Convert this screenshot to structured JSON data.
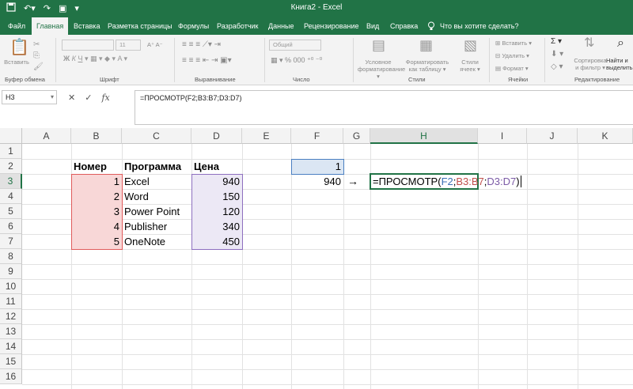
{
  "app": {
    "title": "Книга2 - Excel",
    "qat": {
      "save_icon": "save-icon",
      "undo_icon": "undo-icon",
      "redo_icon": "redo-icon"
    },
    "tell_me": "Что вы хотите сделать?"
  },
  "tabs": [
    "Файл",
    "Главная",
    "Вставка",
    "Разметка страницы",
    "Формулы",
    "Разработчик",
    "Данные",
    "Рецензирование",
    "Вид",
    "Справка"
  ],
  "active_tab": "Главная",
  "ribbon": {
    "groups": [
      "Буфер обмена",
      "Шрифт",
      "Выравнивание",
      "Число",
      "Стили",
      "Ячейки",
      "Редактирование"
    ],
    "paste": "Вставить",
    "font_size": "11",
    "number_format": "Общий",
    "conditional": [
      "Условное",
      "форматирование"
    ],
    "format_table": [
      "Форматировать",
      "как таблицу"
    ],
    "cell_styles": [
      "Стили",
      "ячеек"
    ],
    "cells": [
      "Вставить",
      "Удалить",
      "Формат"
    ],
    "sort": [
      "Сортировка",
      "и фильтр"
    ],
    "find": [
      "Найти и",
      "выделить"
    ]
  },
  "formula_bar": {
    "name_box": "H3",
    "fx": "fx",
    "formula": "=ПРОСМОТР(F2;B3:B7;D3:D7)"
  },
  "columns": [
    "A",
    "B",
    "C",
    "D",
    "E",
    "F",
    "G",
    "H",
    "I",
    "J",
    "K"
  ],
  "rows": [
    "1",
    "2",
    "3",
    "4",
    "5",
    "6",
    "7",
    "8",
    "9",
    "10",
    "11",
    "12",
    "13",
    "14",
    "15",
    "16"
  ],
  "table": {
    "headers": {
      "number": "Номер",
      "program": "Программа",
      "price": "Цена"
    },
    "rows": [
      {
        "number": "1",
        "program": "Excel",
        "price": "940"
      },
      {
        "number": "2",
        "program": "Word",
        "price": "150"
      },
      {
        "number": "3",
        "program": "Power Point",
        "price": "120"
      },
      {
        "number": "4",
        "program": "Publisher",
        "price": "340"
      },
      {
        "number": "5",
        "program": "OneNote",
        "price": "450"
      }
    ]
  },
  "cells": {
    "f2": "1",
    "f3": "940",
    "g3": "→",
    "h3_parts": {
      "prefix": "=ПРОСМОТР(",
      "ref1": "F2",
      "sep1": ";",
      "ref2": "B3:B7",
      "sep2": ";",
      "ref3": "D3:D7",
      "suffix": ")"
    }
  }
}
